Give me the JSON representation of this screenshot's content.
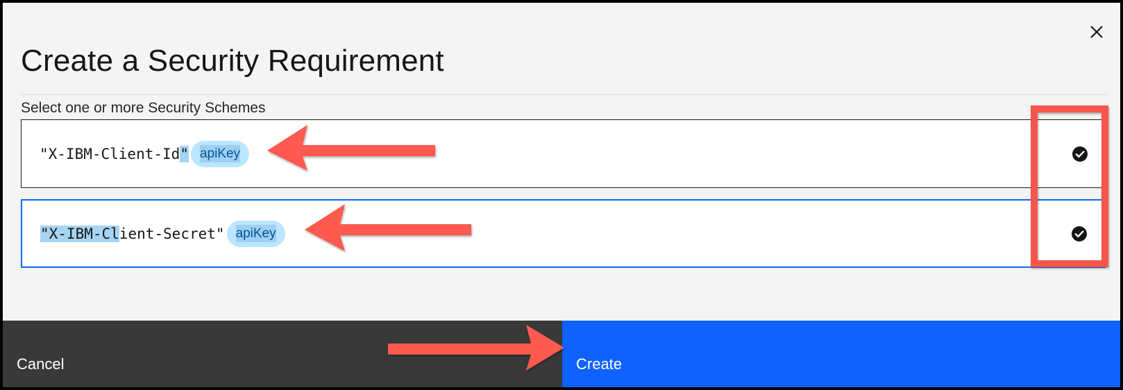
{
  "dialog": {
    "title": "Create a Security Requirement",
    "close_icon": "close-icon",
    "field_label": "Select one or more Security Schemes",
    "schemes": [
      {
        "name_prefix": "\"X-IBM-Client-Id",
        "name_selected": "\"",
        "type": "apiKey",
        "selected": true,
        "check_icon": "checkmark-filled-icon"
      },
      {
        "name_selected": "\"X-IBM-Cl",
        "name_suffix": "ient-Secret\"",
        "type": "apiKey",
        "selected": true,
        "check_icon": "checkmark-filled-icon"
      }
    ],
    "footer": {
      "cancel_label": "Cancel",
      "create_label": "Create"
    }
  },
  "annotations": {
    "arrow_color": "#ff5a4f",
    "highlight_box_color": "#f5564b"
  },
  "colors": {
    "primary": "#0f62fe",
    "secondary": "#393939",
    "tag_bg": "#bae6ff",
    "tag_text": "#00539a",
    "selection": "#a6d4f2"
  }
}
